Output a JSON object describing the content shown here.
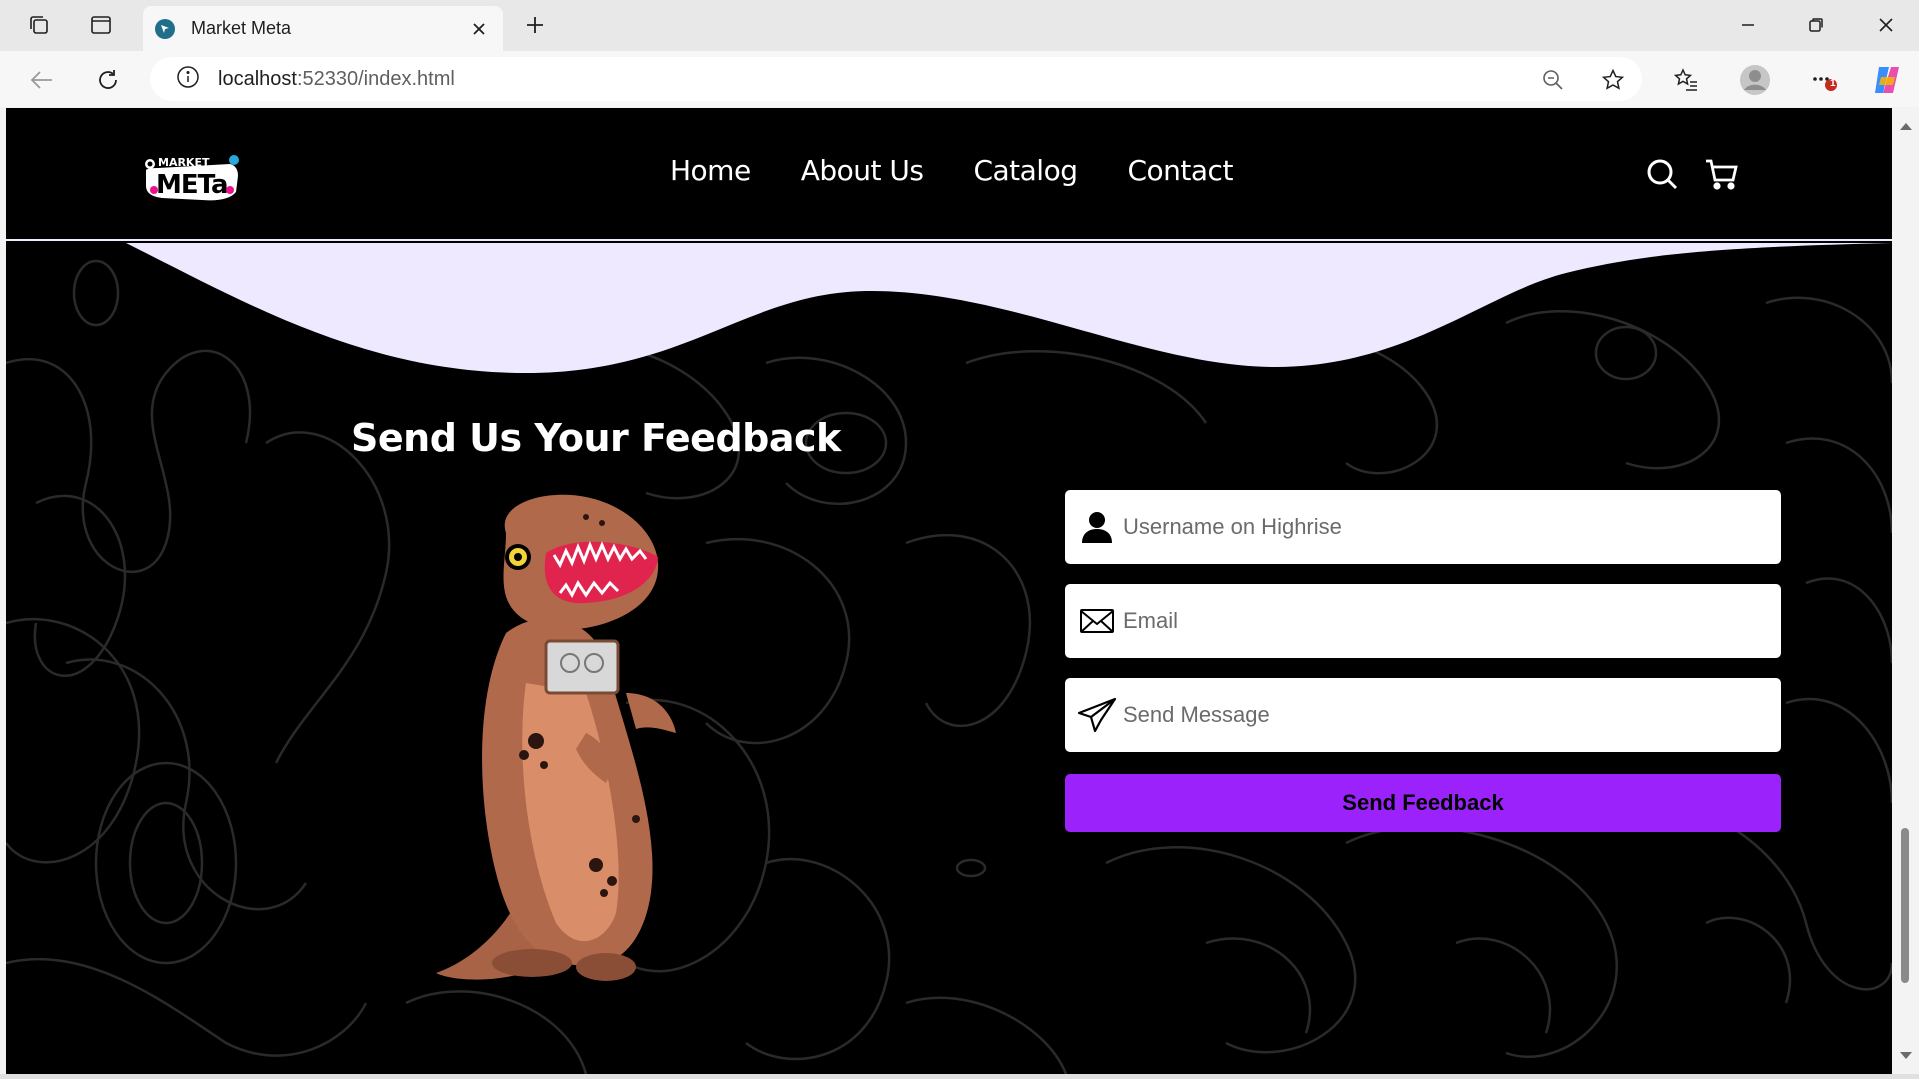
{
  "browser": {
    "tab_title": "Market Meta",
    "url_host": "localhost",
    "url_rest": ":52330/index.html",
    "notification_badge": "1"
  },
  "site": {
    "nav": [
      "Home",
      "About Us",
      "Catalog",
      "Contact"
    ],
    "colors": {
      "accent": "#9b22fb",
      "wave": "#eee9ff",
      "background": "#000000"
    }
  },
  "feedback": {
    "title": "Send Us Your Feedback",
    "username_placeholder": "Username on Highrise",
    "email_placeholder": "Email",
    "message_placeholder": "Send Message",
    "submit_label": "Send Feedback"
  }
}
